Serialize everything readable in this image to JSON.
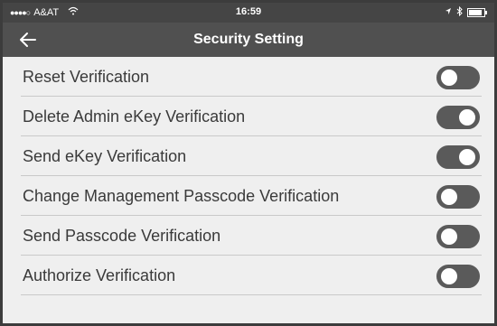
{
  "status_bar": {
    "carrier": "A&AT",
    "time": "16:59",
    "signal_icon": "signal-dots",
    "wifi_icon": "wifi",
    "location_icon": "location-arrow",
    "bluetooth_icon": "bluetooth",
    "battery_icon": "battery"
  },
  "nav": {
    "title": "Security Setting",
    "back_icon": "arrow-left"
  },
  "settings": [
    {
      "label": "Reset Verification",
      "enabled": false
    },
    {
      "label": "Delete Admin eKey Verification",
      "enabled": true
    },
    {
      "label": "Send eKey Verification",
      "enabled": true
    },
    {
      "label": "Change Management Passcode Verification",
      "enabled": false
    },
    {
      "label": "Send Passcode Verification",
      "enabled": false
    },
    {
      "label": "Authorize Verification",
      "enabled": false
    }
  ],
  "colors": {
    "status_bar_bg": "#454545",
    "nav_bar_bg": "#505050",
    "page_bg": "#efefef",
    "toggle": "#5a5a5a"
  }
}
